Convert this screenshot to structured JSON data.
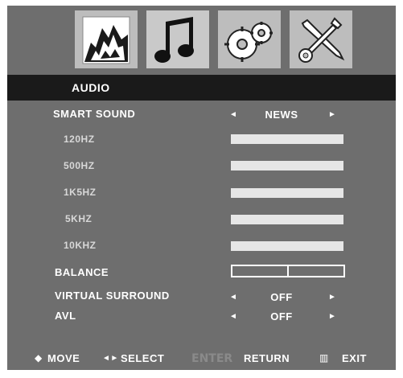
{
  "tabs": [
    {
      "name": "picture",
      "icon": "mountain-icon"
    },
    {
      "name": "audio",
      "icon": "music-note-icon"
    },
    {
      "name": "setup",
      "icon": "gears-icon"
    },
    {
      "name": "tools",
      "icon": "wrench-screwdriver-icon"
    }
  ],
  "header": {
    "title": "AUDIO"
  },
  "smart_sound": {
    "label": "SMART SOUND",
    "value": "NEWS",
    "left": "◄",
    "right": "►"
  },
  "eq": [
    {
      "label": "120HZ"
    },
    {
      "label": "500HZ"
    },
    {
      "label": "1K5HZ"
    },
    {
      "label": "5KHZ"
    },
    {
      "label": "10KHZ"
    }
  ],
  "balance": {
    "label": "BALANCE"
  },
  "virtual_surround": {
    "label": "VIRTUAL SURROUND",
    "value": "OFF",
    "left": "◄",
    "right": "►"
  },
  "avl": {
    "label": "AVL",
    "value": "OFF",
    "left": "◄",
    "right": "►"
  },
  "footer": {
    "move_icon": "◆",
    "move": "MOVE",
    "select_icon": "◄►",
    "select": "SELECT",
    "enter_key": "ENTER",
    "return": "RETURN",
    "exit_icon": "▥",
    "exit": "EXIT"
  }
}
